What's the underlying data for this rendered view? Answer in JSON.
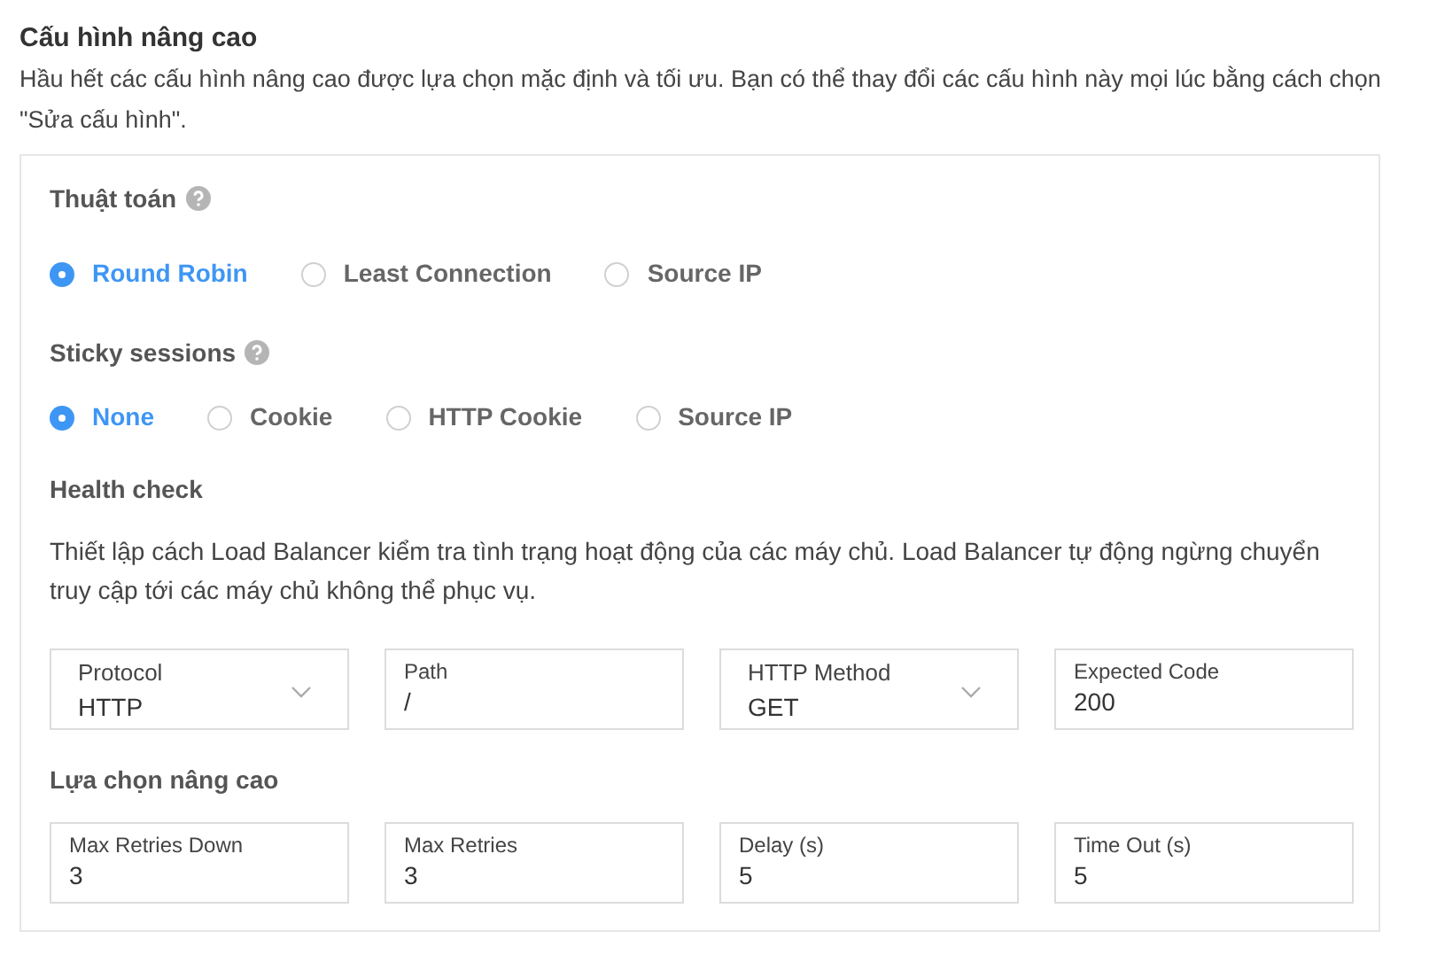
{
  "title": "Cấu hình nâng cao",
  "description": "Hầu hết các cấu hình nâng cao được lựa chọn mặc định và tối ưu. Bạn có thể thay đổi các cấu hình này mọi lúc bằng cách chọn \"Sửa cấu hình\".",
  "algorithm": {
    "label": "Thuật toán",
    "options": [
      {
        "label": "Round Robin",
        "selected": true
      },
      {
        "label": "Least Connection",
        "selected": false
      },
      {
        "label": "Source IP",
        "selected": false
      }
    ]
  },
  "sticky_sessions": {
    "label": "Sticky sessions",
    "options": [
      {
        "label": "None",
        "selected": true
      },
      {
        "label": "Cookie",
        "selected": false
      },
      {
        "label": "HTTP Cookie",
        "selected": false
      },
      {
        "label": "Source IP",
        "selected": false
      }
    ]
  },
  "health_check": {
    "label": "Health check",
    "description": "Thiết lập cách Load Balancer kiểm tra tình trạng hoạt động của các máy chủ. Load Balancer tự động ngừng chuyển truy cập tới các máy chủ không thể phục vụ.",
    "fields": [
      {
        "kind": "select",
        "label": "Protocol",
        "value": "HTTP"
      },
      {
        "kind": "input",
        "label": "Path",
        "value": "/"
      },
      {
        "kind": "select",
        "label": "HTTP Method",
        "value": "GET"
      },
      {
        "kind": "input",
        "label": "Expected Code",
        "value": "200"
      }
    ]
  },
  "advanced": {
    "label": "Lựa chọn nâng cao",
    "fields": [
      {
        "kind": "input",
        "label": "Max Retries Down",
        "value": "3"
      },
      {
        "kind": "input",
        "label": "Max Retries",
        "value": "3"
      },
      {
        "kind": "input",
        "label": "Delay (s)",
        "value": "5"
      },
      {
        "kind": "input",
        "label": "Time Out (s)",
        "value": "5"
      }
    ]
  }
}
